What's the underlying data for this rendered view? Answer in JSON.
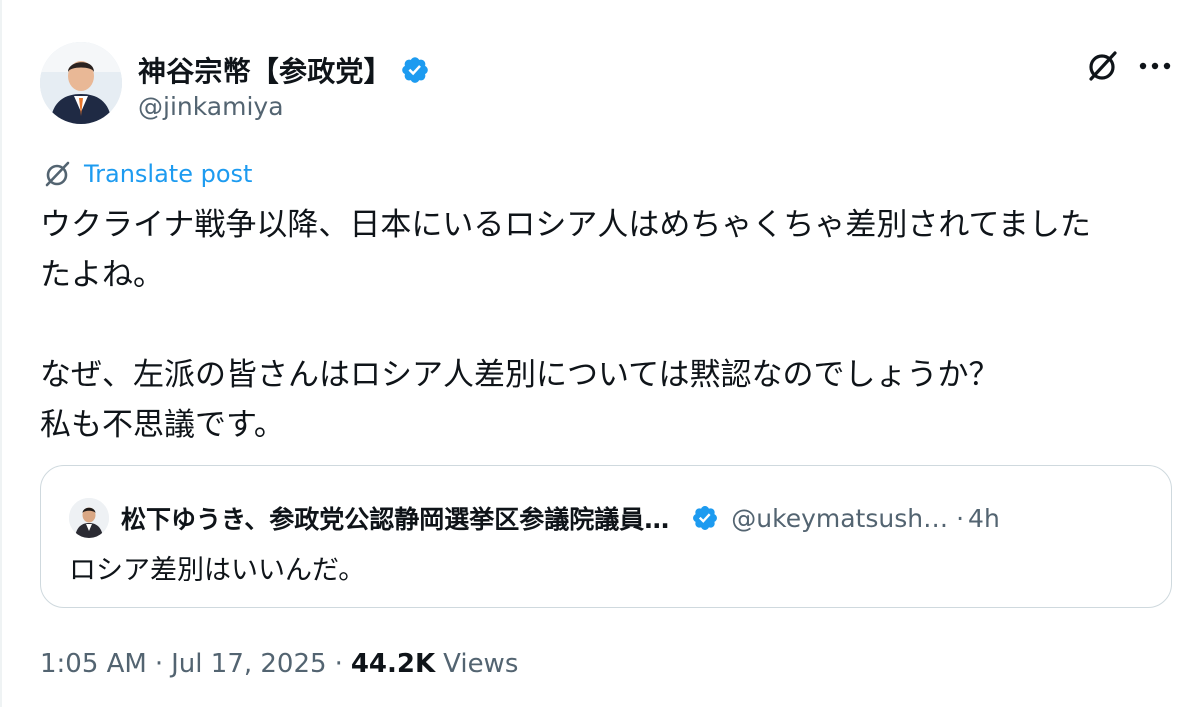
{
  "author": {
    "display_name": "神谷宗幣【参政党】",
    "handle": "@jinkamiya"
  },
  "icons": {
    "verified": "verified-badge-icon",
    "grok": "grok-icon",
    "more": "more-options-icon"
  },
  "translate": {
    "label": "Translate post"
  },
  "post": {
    "text": "ウクライナ戦争以降、日本にいるロシア人はめちゃくちゃ差別されてました\nたよね。\n\nなぜ、左派の皆さんはロシア人差別については黙認なのでしょうか？\n私も不思議です。"
  },
  "quote": {
    "display_name": "松下ゆうき、参政党公認静岡選挙区参議院議員…",
    "handle": "@ukeymatsush…",
    "separator": "·",
    "time": "4h",
    "text": "ロシア差別はいいんだ。"
  },
  "meta": {
    "time": "1:05 AM",
    "sep1": "·",
    "date": "Jul 17, 2025",
    "sep2": "·",
    "views_count": "44.2K",
    "views_label": "Views"
  },
  "colors": {
    "accent": "#1d9bf0",
    "secondary_text": "#536471",
    "border": "#cfd9de"
  }
}
